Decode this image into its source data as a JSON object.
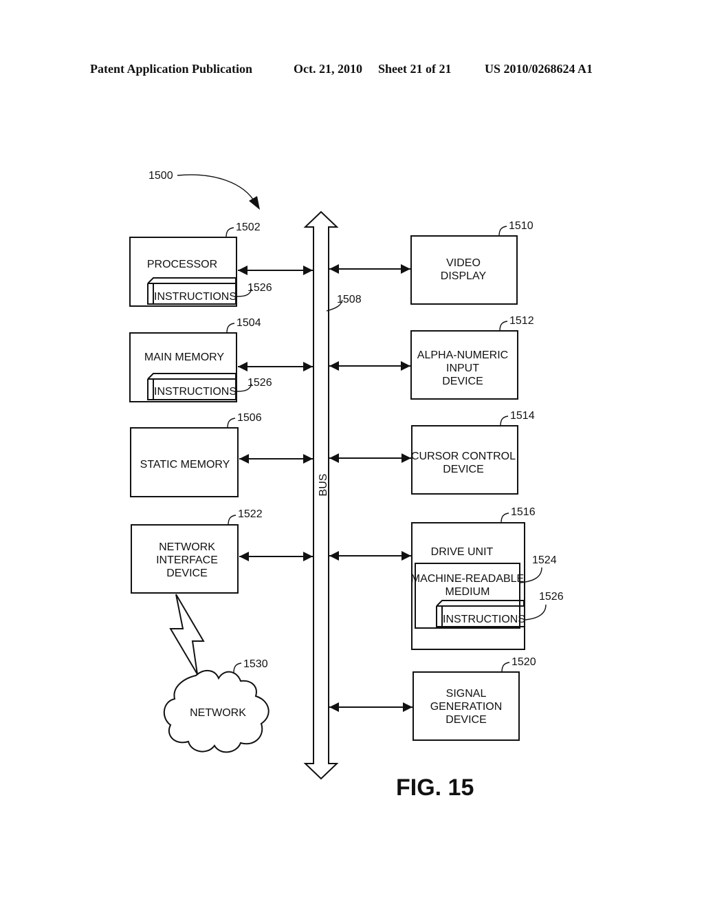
{
  "header": {
    "publication": "Patent Application Publication",
    "date": "Oct. 21, 2010",
    "sheet": "Sheet 21 of 21",
    "number": "US 2010/0268624 A1"
  },
  "figure": {
    "label": "FIG. 15",
    "system_ref": "1500",
    "bus": {
      "label": "BUS",
      "ref": "1508"
    },
    "left_blocks": [
      {
        "id": "processor",
        "ref": "1502",
        "lines": [
          "PROCESSOR"
        ],
        "sub": {
          "label": "INSTRUCTIONS",
          "ref": "1526"
        }
      },
      {
        "id": "main-memory",
        "ref": "1504",
        "lines": [
          "MAIN MEMORY"
        ],
        "sub": {
          "label": "INSTRUCTIONS",
          "ref": "1526"
        }
      },
      {
        "id": "static-memory",
        "ref": "1506",
        "lines": [
          "STATIC MEMORY"
        ]
      },
      {
        "id": "network-interface-device",
        "ref": "1522",
        "lines": [
          "NETWORK",
          "INTERFACE",
          "DEVICE"
        ]
      }
    ],
    "right_blocks": [
      {
        "id": "video-display",
        "ref": "1510",
        "lines": [
          "VIDEO",
          "DISPLAY"
        ]
      },
      {
        "id": "alpha-numeric-input-device",
        "ref": "1512",
        "lines": [
          "ALPHA-NUMERIC",
          "INPUT",
          "DEVICE"
        ]
      },
      {
        "id": "cursor-control-device",
        "ref": "1514",
        "lines": [
          "CURSOR CONTROL",
          "DEVICE"
        ]
      },
      {
        "id": "drive-unit",
        "ref": "1516",
        "lines": [
          "DRIVE UNIT"
        ],
        "medium": {
          "lines": [
            "MACHINE-READABLE",
            "MEDIUM"
          ],
          "ref": "1524"
        },
        "sub": {
          "label": "INSTRUCTIONS",
          "ref": "1526"
        }
      },
      {
        "id": "signal-generation-device",
        "ref": "1520",
        "lines": [
          "SIGNAL",
          "GENERATION",
          "DEVICE"
        ]
      }
    ],
    "network": {
      "label": "NETWORK",
      "ref": "1530"
    }
  }
}
